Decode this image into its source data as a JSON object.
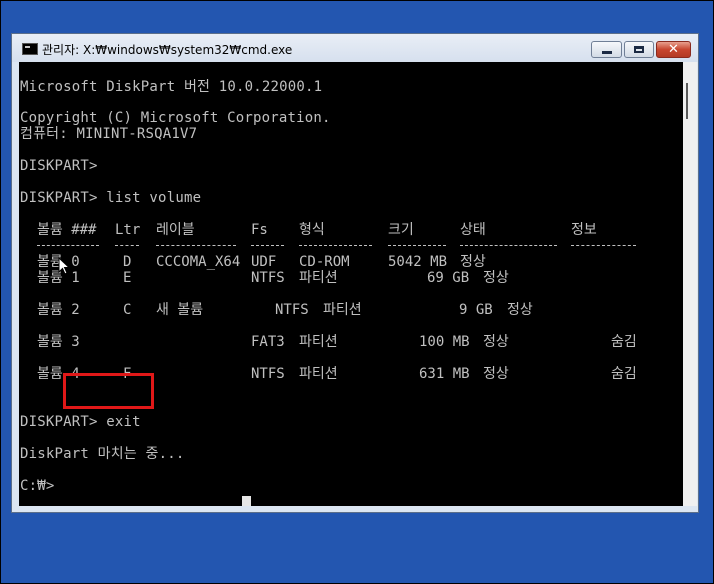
{
  "window": {
    "title": "관리자: X:₩windows₩system32₩cmd.exe",
    "buttons": {
      "minimize": "minimize",
      "maximize": "maximize",
      "close": "✕"
    }
  },
  "console": {
    "version_line": "Microsoft DiskPart 버전 10.0.22000.1",
    "copyright_line": "Copyright (C) Microsoft Corporation.",
    "computer_line": "컴퓨터: MININT-RSQA1V7",
    "prompt1": "DISKPART>",
    "prompt2": "DISKPART> list volume",
    "headers": [
      "볼륨 ###",
      "Ltr",
      "레이블",
      "Fs",
      "형식",
      "크기",
      "상태",
      "정보"
    ],
    "rows": [
      {
        "vol": "볼륨 0",
        "ltr": "D",
        "label": "CCCOMA_X64",
        "fs": "UDF",
        "type": "CD-ROM",
        "size": "5042 MB",
        "status": "정상",
        "info": ""
      },
      {
        "vol": "볼륨 1",
        "ltr": "E",
        "label": "",
        "fs": "NTFS",
        "type": "파티션",
        "size": "69 GB",
        "status": "정상",
        "info": ""
      },
      {
        "vol": "볼륨 2",
        "ltr": "C",
        "label": "새 볼륨",
        "fs": "NTFS",
        "type": "파티션",
        "size": "9 GB",
        "status": "정상",
        "info": ""
      },
      {
        "vol": "볼륨 3",
        "ltr": "",
        "label": "",
        "fs": "FAT3",
        "type": "파티션",
        "size": "100 MB",
        "status": "정상",
        "info": "숨김"
      },
      {
        "vol": "볼륨 4",
        "ltr": "F",
        "label": "",
        "fs": "NTFS",
        "type": "파티션",
        "size": "631 MB",
        "status": "정상",
        "info": "숨김"
      }
    ],
    "exit_line": "DISKPART> exit",
    "ending_line": "DiskPart 마치는 중...",
    "final_prompt": "C:₩>"
  },
  "colors": {
    "console_bg": "#000000",
    "console_text": "#c0c0c0",
    "highlight": "#e01818",
    "desktop": "#2356b0"
  },
  "icons": {
    "title": "cmd-icon",
    "pointer": "mouse-pointer-icon"
  }
}
